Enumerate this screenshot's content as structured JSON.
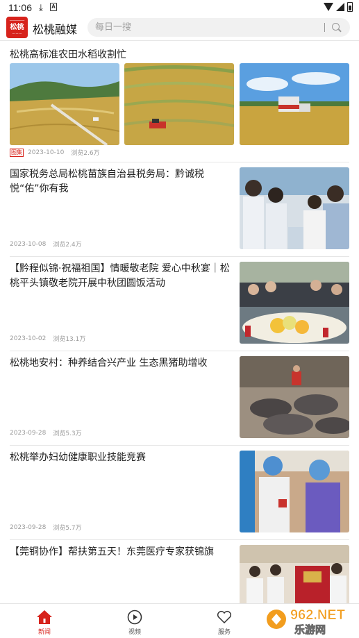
{
  "status": {
    "time": "11:06"
  },
  "header": {
    "logo_text": "松桃",
    "app_name": "松桃融媒",
    "search_placeholder": "每日一搜"
  },
  "gallery": {
    "title": "松桃高标准农田水稻收割忙",
    "tag": "图集",
    "date": "2023-10-10",
    "views": "浏览2.6万"
  },
  "articles": [
    {
      "title": "国家税务总局松桃苗族自治县税务局：黔诚税悦“佑”你有我",
      "date": "2023-10-08",
      "views": "浏览2.4万",
      "image": "tax-officials-photo"
    },
    {
      "title": "【黔程似锦·祝福祖国】情暖敬老院 爱心中秋宴｜松桃平头镇敬老院开展中秋团圆饭活动",
      "date": "2023-10-02",
      "views": "浏览13.1万",
      "image": "nursing-home-feast-photo"
    },
    {
      "title": "松桃地安村：种养结合兴产业 生态黑猪助增收",
      "date": "2023-09-28",
      "views": "浏览5.3万",
      "image": "black-pigs-photo"
    },
    {
      "title": "松桃举办妇幼健康职业技能竞赛",
      "date": "2023-09-28",
      "views": "浏览5.7万",
      "image": "medical-skills-photo"
    },
    {
      "title": "【莞铜协作】帮扶第五天！东莞医疗专家获锦旗",
      "date": "",
      "views": "",
      "image": "banner-award-photo"
    }
  ],
  "tabs": [
    {
      "label": "新闻",
      "icon": "home-icon",
      "active": true
    },
    {
      "label": "视频",
      "icon": "play-icon",
      "active": false
    },
    {
      "label": "服务",
      "icon": "heart-icon",
      "active": false
    }
  ],
  "watermark": {
    "text_top": "962.NET",
    "text_bottom": "乐游网"
  },
  "colors": {
    "brand": "#d7231c",
    "meta": "#9a9a9a"
  }
}
